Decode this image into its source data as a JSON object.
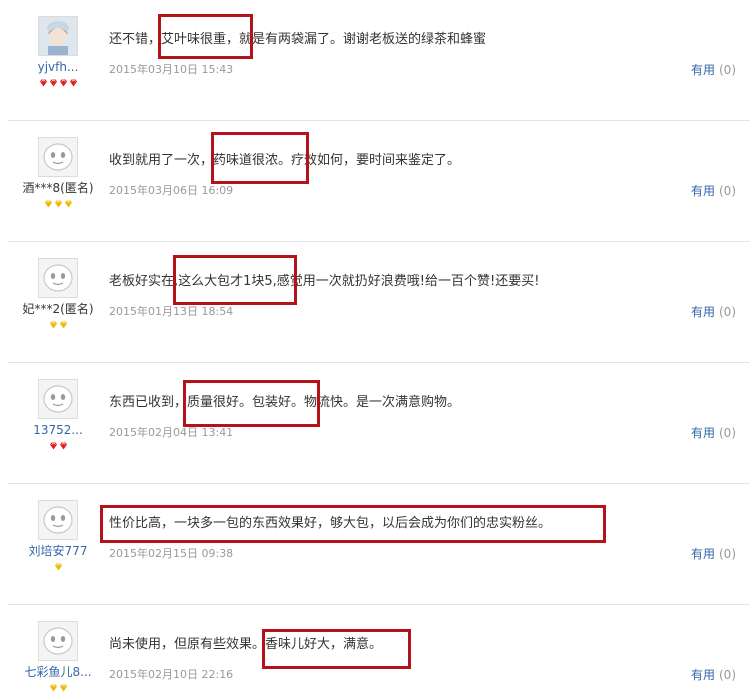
{
  "reviews": [
    {
      "user": "yjvfh...",
      "avatar": "avatar-photo",
      "badge": "red-diamond",
      "badge_count": 4,
      "text": "还不错，艾叶味很重，就是有两袋漏了。谢谢老板送的绿茶和蜂蜜",
      "date": "2015年03月10日 15:43",
      "useful_label": "有用",
      "useful_count": "(0)"
    },
    {
      "user": "酒***8(匿名)",
      "avatar": "default-face",
      "badge": "yellow-diamond",
      "badge_count": 3,
      "text": "收到就用了一次，药味道很浓。疗效如何，要时间来鉴定了。",
      "date": "2015年03月06日 16:09",
      "useful_label": "有用",
      "useful_count": "(0)"
    },
    {
      "user": "妃***2(匿名)",
      "avatar": "default-face",
      "badge": "yellow-diamond",
      "badge_count": 2,
      "text": "老板好实在,这么大包才1块5,感觉用一次就扔好浪费哦!给一百个赞!还要买!",
      "date": "2015年01月13日 18:54",
      "useful_label": "有用",
      "useful_count": "(0)"
    },
    {
      "user": "13752...",
      "avatar": "default-face",
      "badge": "red-diamond",
      "badge_count": 2,
      "text": "东西已收到，质量很好。包装好。物流快。是一次满意购物。",
      "date": "2015年02月04日 13:41",
      "useful_label": "有用",
      "useful_count": "(0)"
    },
    {
      "user": "刘培安777",
      "avatar": "default-face",
      "badge": "yellow-diamond",
      "badge_count": 1,
      "text": "性价比高，一块多一包的东西效果好，够大包，以后会成为你们的忠实粉丝。",
      "date": "2015年02月15日 09:38",
      "useful_label": "有用",
      "useful_count": "(0)"
    },
    {
      "user": "七彩鱼儿8...",
      "avatar": "default-face",
      "badge": "yellow-diamond",
      "badge_count": 2,
      "text": "尚未使用，但原有些效果。香味儿好大，满意。",
      "date": "2015年02月10日 22:16",
      "useful_label": "有用",
      "useful_count": "(0)"
    }
  ],
  "colors": {
    "highlight_border": "#b3121a",
    "link": "#3366aa",
    "date": "#999999",
    "text": "#333333",
    "badge_red": "#e02020",
    "badge_yellow": "#f0b800"
  }
}
